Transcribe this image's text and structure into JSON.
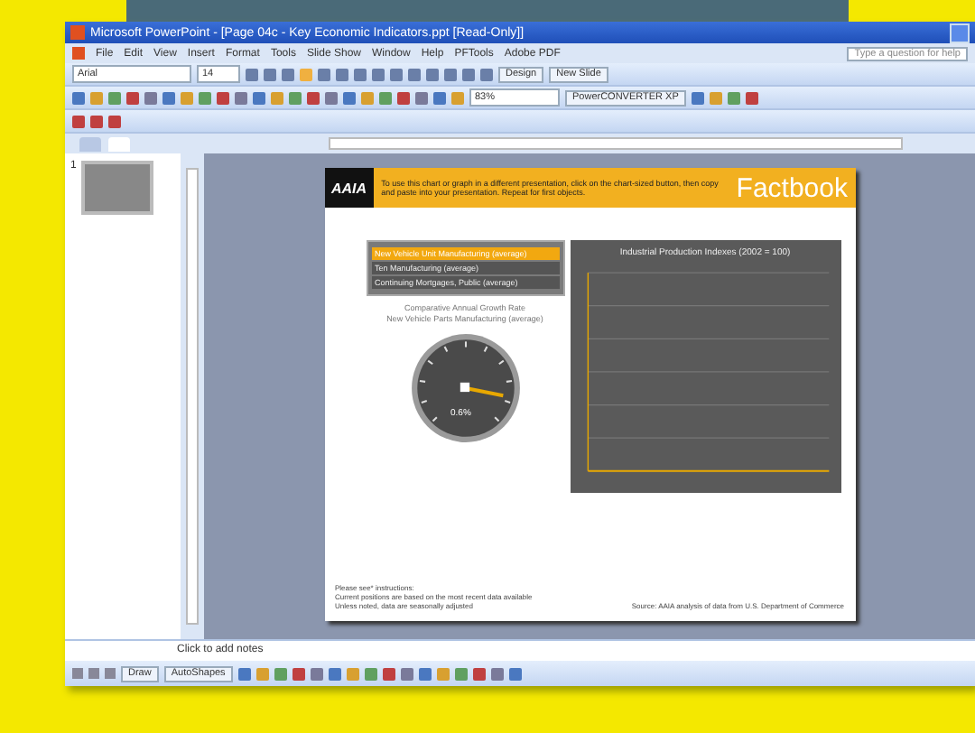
{
  "window": {
    "title": "Microsoft PowerPoint - [Page 04c - Key Economic Indicators.ppt [Read-Only]]"
  },
  "menu": [
    "File",
    "Edit",
    "View",
    "Insert",
    "Format",
    "Tools",
    "Slide Show",
    "Window",
    "Help",
    "PFTools",
    "Adobe PDF"
  ],
  "help_box": {
    "placeholder": "Type a question for help"
  },
  "formatting_toolbar": {
    "font": "Arial",
    "size": "14",
    "design": "Design",
    "new_slide": "New Slide"
  },
  "standard_toolbar": {
    "zoom": "83%",
    "converter": "PowerCONVERTER XP"
  },
  "pane_tabs": [
    {
      "selected": false
    },
    {
      "selected": true
    }
  ],
  "slide_number": "1",
  "slide": {
    "logo": "AAIA",
    "instruction": "To use this chart or graph in a different presentation, click on the chart-sized button, then copy and paste into your presentation. Repeat for first objects.",
    "brand": "Factbook",
    "options": [
      {
        "label": "New Vehicle Unit Manufacturing (average)",
        "selected": true
      },
      {
        "label": "Ten Manufacturing (average)",
        "selected": false
      },
      {
        "label": "Continuing Mortgages, Public (average)",
        "selected": false
      }
    ],
    "gauge": {
      "title": "Comparative Annual Growth Rate",
      "subtitle": "New Vehicle Parts Manufacturing (average)",
      "reading": "0.6%"
    },
    "chart_title": "Industrial Production Indexes (2002 = 100)",
    "notes_left": [
      "Please see* instructions:",
      "Current positions are based on the most recent data available",
      "Unless noted, data are seasonally adjusted"
    ],
    "source": "Source: AAIA analysis of data from U.S. Department of Commerce"
  },
  "notes": {
    "placeholder": "Click to add notes"
  },
  "drawing_toolbar": {
    "draw": "Draw",
    "autoshapes": "AutoShapes"
  }
}
